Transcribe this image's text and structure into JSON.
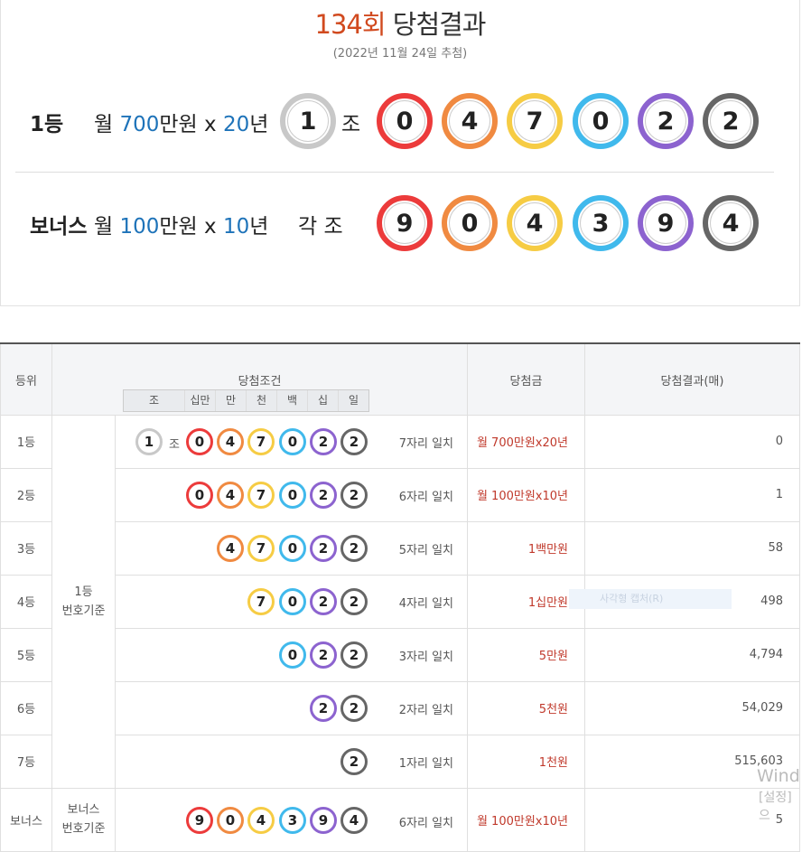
{
  "header": {
    "round": "134회",
    "suffix": " 당첨결과",
    "date": "(2022년 11월 24일 추첨)"
  },
  "first": {
    "label": "1등",
    "pre": "월 ",
    "amount": "700",
    "mid": "만원 x ",
    "years": "20",
    "post": "년",
    "group": "1",
    "jo": "조",
    "numbers": [
      "0",
      "4",
      "7",
      "0",
      "2",
      "2"
    ]
  },
  "bonus": {
    "label": "보너스",
    "pre": "월 ",
    "amount": "100",
    "mid": "만원 x ",
    "years": "10",
    "post": "년",
    "group_label": "각 조",
    "numbers": [
      "9",
      "0",
      "4",
      "3",
      "9",
      "4"
    ]
  },
  "table": {
    "headers": {
      "rank": "등위",
      "condition": "당첨조건",
      "prize": "당첨금",
      "result": "당첨결과(매)"
    },
    "subheaders": [
      "조",
      "십만",
      "만",
      "천",
      "백",
      "십",
      "일"
    ],
    "basis_first": "1등\n번호기준",
    "basis_bonus": "보너스\n번호기준",
    "rows": [
      {
        "rank": "1등",
        "match": "7자리 일치",
        "prize": "월 700만원x20년",
        "count": "0"
      },
      {
        "rank": "2등",
        "match": "6자리 일치",
        "prize": "월 100만원x10년",
        "count": "1"
      },
      {
        "rank": "3등",
        "match": "5자리 일치",
        "prize": "1백만원",
        "count": "58"
      },
      {
        "rank": "4등",
        "match": "4자리 일치",
        "prize": "1십만원",
        "count": "498"
      },
      {
        "rank": "5등",
        "match": "3자리 일치",
        "prize": "5만원",
        "count": "4,794"
      },
      {
        "rank": "6등",
        "match": "2자리 일치",
        "prize": "5천원",
        "count": "54,029"
      },
      {
        "rank": "7등",
        "match": "1자리 일치",
        "prize": "1천원",
        "count": "515,603"
      },
      {
        "rank": "보너스",
        "match": "6자리 일치",
        "prize": "월 100만원x10년",
        "count": "5"
      }
    ]
  },
  "overlay": {
    "ghost_text": "사각형 캡처(R)",
    "windows_line1": "Wind",
    "windows_line2": "[설정]으"
  },
  "colors": {
    "red": "#ec3b3b",
    "orange": "#f08a41",
    "yellow": "#f6cc44",
    "blue": "#40b9ec",
    "purple": "#8c63cf",
    "gray": "#666666",
    "accent": "#d14a1f"
  }
}
